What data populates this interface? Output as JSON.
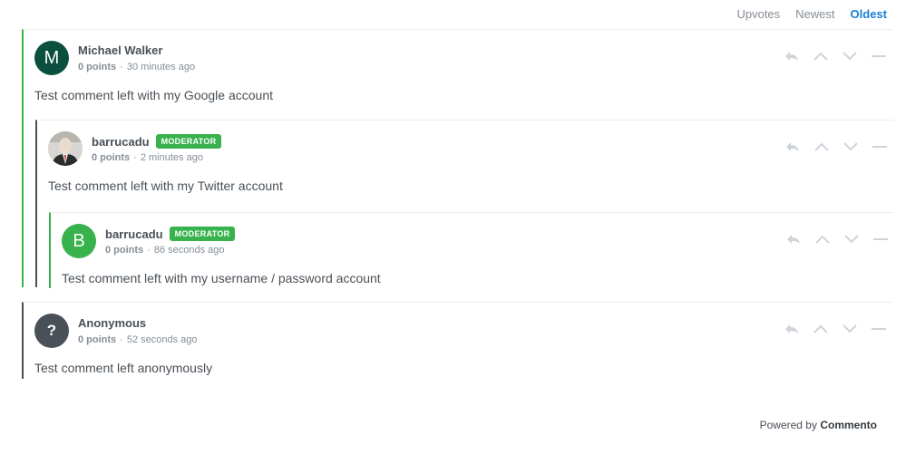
{
  "sort": {
    "options": [
      "Upvotes",
      "Newest",
      "Oldest"
    ],
    "active": "Oldest"
  },
  "comments": [
    {
      "author": "Michael Walker",
      "avatar_letter": "M",
      "avatar_color": "#0b4f3f",
      "points": "0 points",
      "time": "30 minutes ago",
      "text": "Test comment left with my Google account",
      "badge": "",
      "replies": [
        {
          "author": "barrucadu",
          "avatar_letter": "",
          "points": "0 points",
          "time": "2 minutes ago",
          "text": "Test comment left with my Twitter account",
          "badge": "MODERATOR",
          "replies": [
            {
              "author": "barrucadu",
              "avatar_letter": "B",
              "avatar_color": "#37b24d",
              "points": "0 points",
              "time": "86 seconds ago",
              "text": "Test comment left with my username / password account",
              "badge": "MODERATOR"
            }
          ]
        }
      ]
    },
    {
      "author": "Anonymous",
      "avatar_letter": "?",
      "avatar_color": "#495057",
      "points": "0 points",
      "time": "52 seconds ago",
      "text": "Test comment left anonymously",
      "badge": ""
    }
  ],
  "footer": {
    "prefix": "Powered by",
    "brand": "Commento"
  },
  "colors": {
    "accent": "#1c7ed6",
    "moderator": "#37b24d",
    "text": "#495057",
    "muted": "#868e96"
  },
  "icons": [
    "reply-icon",
    "upvote-icon",
    "downvote-icon",
    "collapse-icon"
  ]
}
